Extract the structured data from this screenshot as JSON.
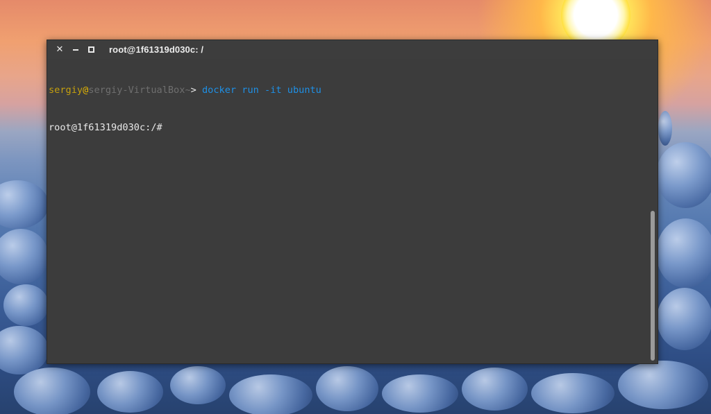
{
  "window": {
    "title": "root@1f61319d030c: /"
  },
  "terminal": {
    "prompt_user": "sergiy",
    "prompt_at": "@",
    "prompt_host": "sergiy-VirtualBox",
    "prompt_path": "~",
    "prompt_symbol": "> ",
    "command": "docker run -it ubuntu",
    "root_prompt": "root@1f61319d030c:/#"
  },
  "icons": {
    "close": "close-icon",
    "minimize": "minimize-icon",
    "maximize": "maximize-icon"
  },
  "colors": {
    "terminal_bg": "#3c3c3c",
    "user": "#c5a00e",
    "host": "#6f6f6f",
    "command": "#1e90e6",
    "text": "#e8e8e8"
  }
}
